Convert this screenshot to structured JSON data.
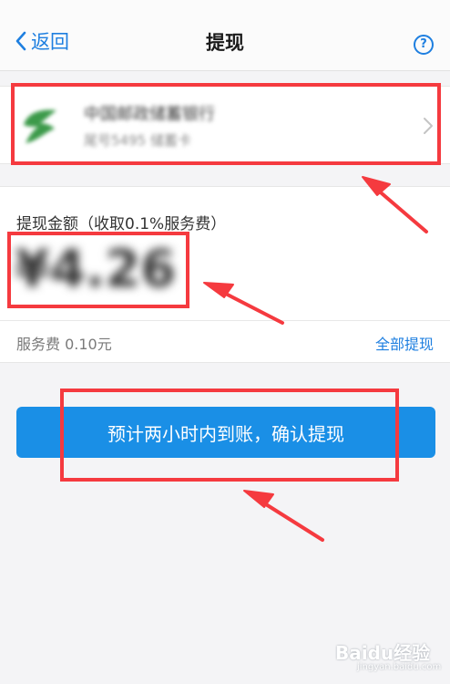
{
  "nav": {
    "back_label": "返回",
    "title": "提现",
    "help_symbol": "?"
  },
  "bank": {
    "name": "中国邮政储蓄银行",
    "account": "尾号5495 储蓄卡",
    "logo_color": "#3c9a4a"
  },
  "withdraw": {
    "amount_label": "提现金额（收取0.1%服务费）",
    "amount": "¥4.26",
    "fee": "服务费 0.10元",
    "withdraw_all_label": "全部提现"
  },
  "confirm_button_label": "预计两小时内到账，确认提现",
  "colors": {
    "accent": "#1e7fe0",
    "button": "#1a8fe6",
    "annotation": "#f53a3f"
  },
  "watermark": {
    "brand": "Baidu经验",
    "url": "jingyan.baidu.com"
  }
}
